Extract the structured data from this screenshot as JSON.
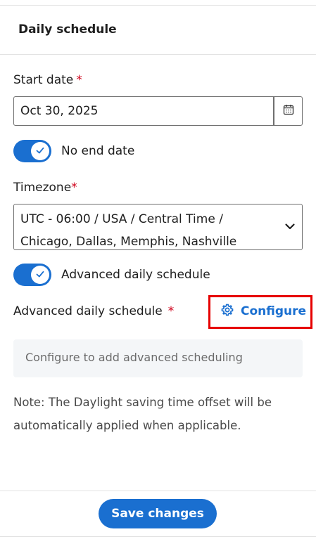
{
  "header": {
    "title": "Daily schedule"
  },
  "start_date": {
    "label": "Start date",
    "required_mark": "*",
    "value": "Oct 30, 2025",
    "calendar_icon": "calendar-icon"
  },
  "no_end_date": {
    "label": "No end date",
    "checked": true
  },
  "timezone": {
    "label": "Timezone",
    "required_mark": "*",
    "value_line1": "UTC - 06:00 / USA / Central Time /",
    "value_line2": "Chicago, Dallas, Memphis, Nashville",
    "chevron_icon": "chevron-down-icon"
  },
  "advanced_toggle": {
    "label": "Advanced daily schedule",
    "checked": true
  },
  "advanced_field": {
    "label": "Advanced daily schedule",
    "required_mark": "*",
    "configure_label": "Configure",
    "configure_icon": "gear-icon",
    "placeholder": "Configure to add advanced scheduling"
  },
  "note": "Note: The Daylight saving time offset will be automatically applied when applicable.",
  "footer": {
    "save_label": "Save changes"
  },
  "colors": {
    "accent": "#1a6fd0",
    "required": "#d0021b",
    "highlight_box": "#e60000"
  }
}
